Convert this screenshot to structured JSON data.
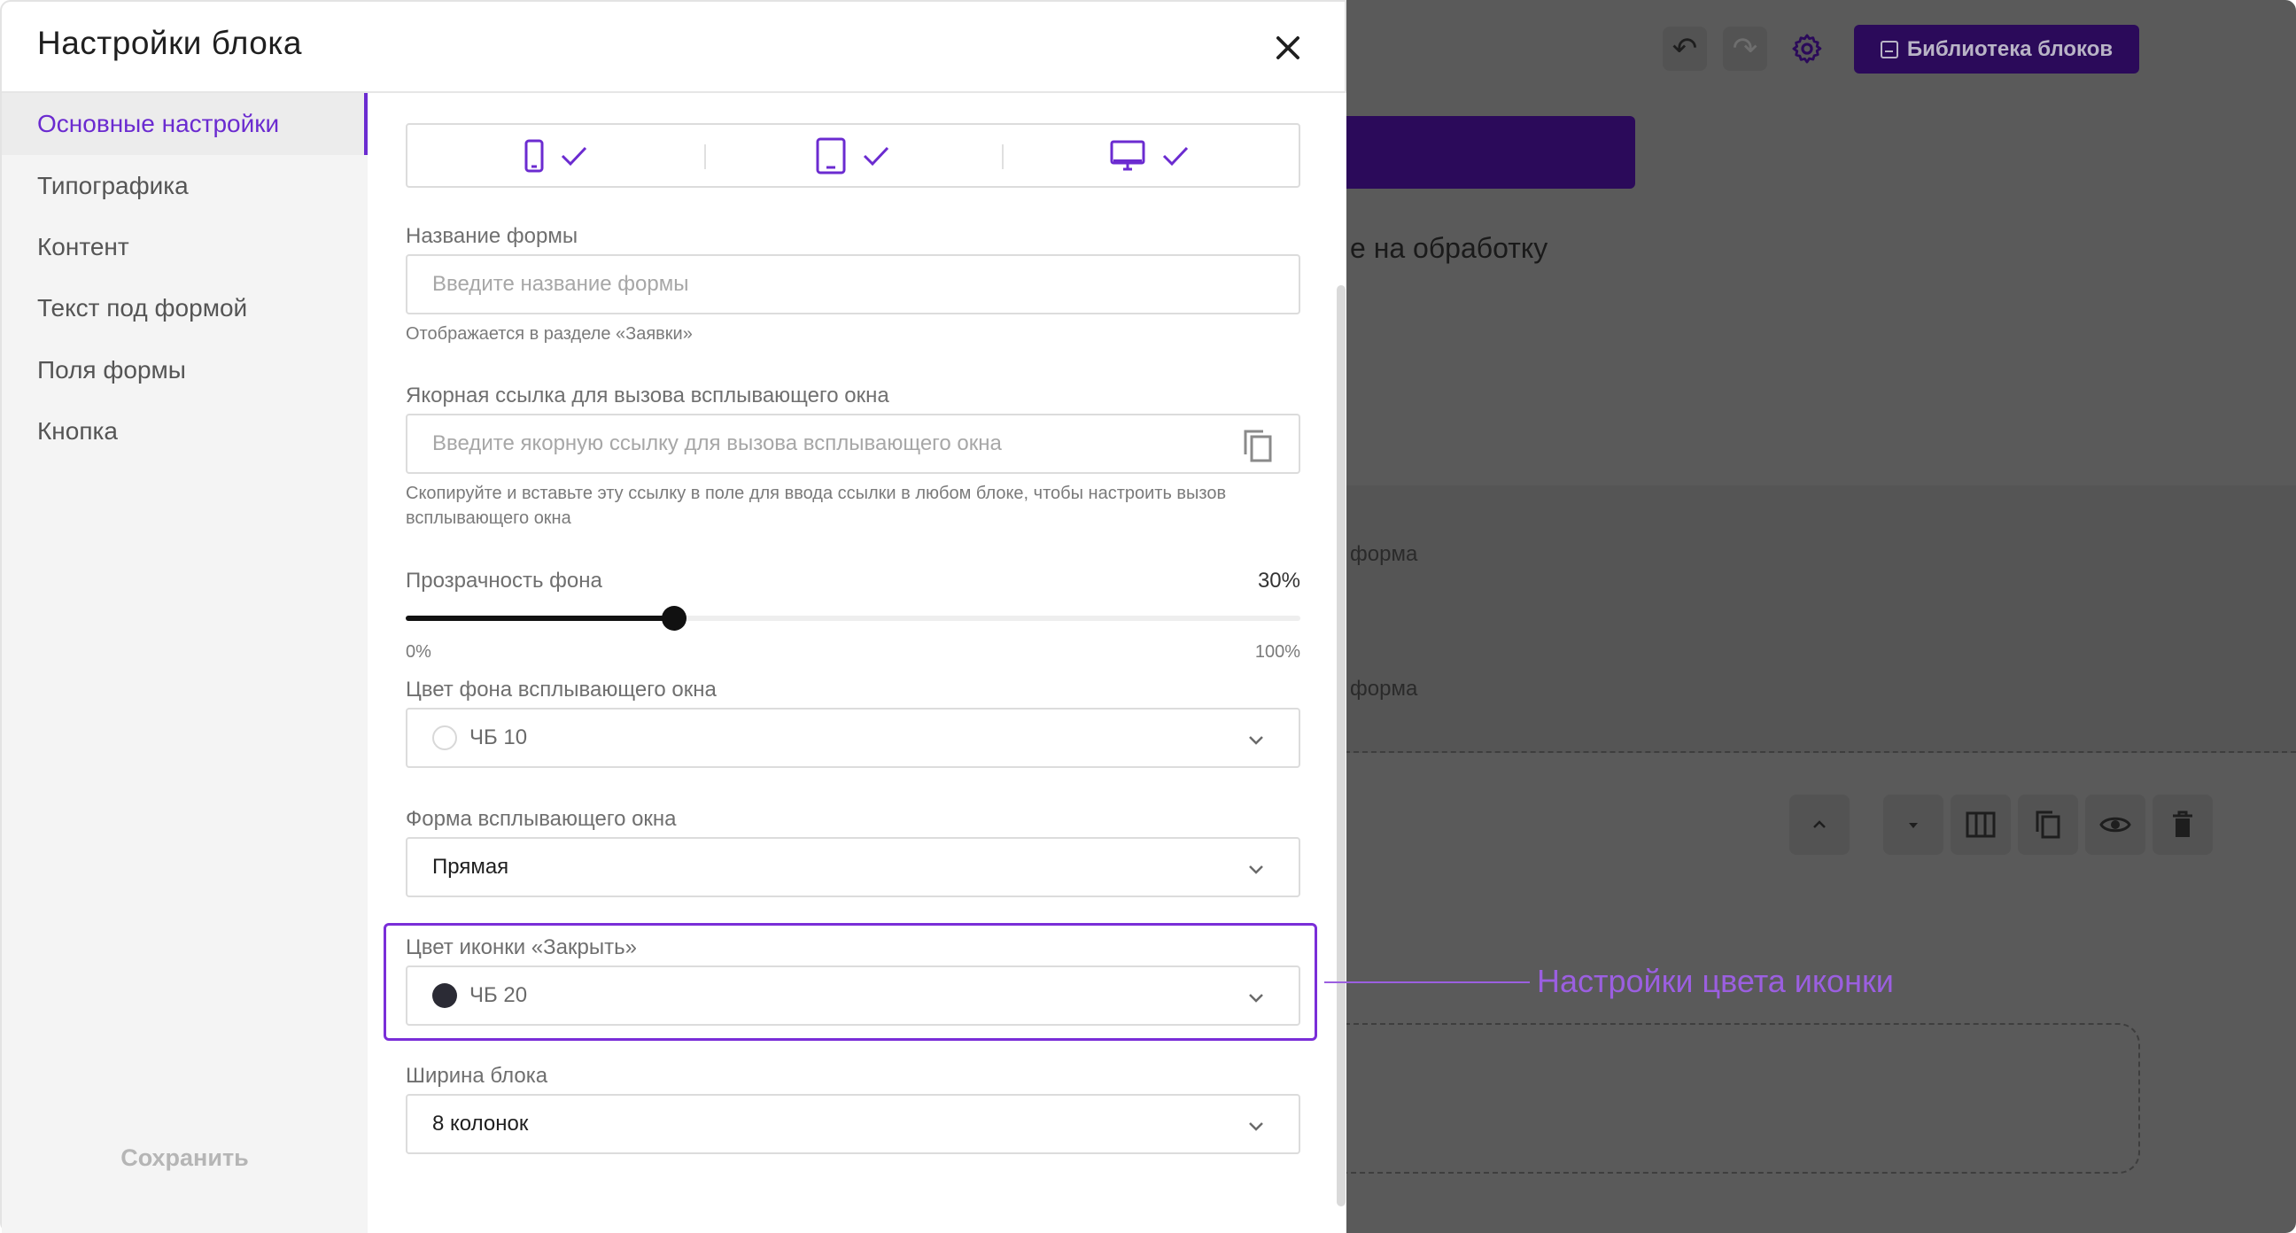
{
  "modal": {
    "title": "Настройки блока",
    "save_label": "Сохранить"
  },
  "sidebar": {
    "items": [
      {
        "label": "Основные настройки",
        "active": true
      },
      {
        "label": "Типографика",
        "active": false
      },
      {
        "label": "Контент",
        "active": false
      },
      {
        "label": "Текст под формой",
        "active": false
      },
      {
        "label": "Поля формы",
        "active": false
      },
      {
        "label": "Кнопка",
        "active": false
      }
    ]
  },
  "devices": {
    "icons": [
      "mobile-icon",
      "tablet-icon",
      "desktop-icon"
    ],
    "enabled": [
      true,
      true,
      true
    ]
  },
  "form_name": {
    "label": "Название формы",
    "placeholder": "Введите название формы",
    "hint": "Отображается в разделе «Заявки»"
  },
  "anchor_link": {
    "label": "Якорная ссылка для вызова всплывающего окна",
    "placeholder": "Введите якорную ссылку для вызова всплывающего окна",
    "hint": "Скопируйте и вставьте эту ссылку в поле для ввода ссылки в любом блоке, чтобы настроить вызов всплывающего окна"
  },
  "opacity": {
    "label": "Прозрачность фона",
    "value_label": "30%",
    "value": 30,
    "min_label": "0%",
    "max_label": "100%"
  },
  "bg_color": {
    "label": "Цвет фона всплывающего окна",
    "value": "ЧБ 10",
    "swatch": "#ffffff"
  },
  "popup_shape": {
    "label": "Форма всплывающего окна",
    "value": "Прямая"
  },
  "close_icon_color": {
    "label": "Цвет иконки «Закрыть»",
    "value": "ЧБ 20",
    "swatch": "#2b2b35"
  },
  "block_width": {
    "label": "Ширина блока",
    "value": "8 колонок"
  },
  "annotation": {
    "text": "Настройки цвета иконки"
  },
  "background_editor": {
    "library_button": "Библиотека блоков",
    "text_fragment": "е на обработку",
    "form_fragment_1": "форма",
    "form_fragment_2": "форма"
  },
  "colors": {
    "accent": "#6b2bd0",
    "annotation": "#9b5fe0",
    "dark_purple": "#2b0a5a"
  }
}
